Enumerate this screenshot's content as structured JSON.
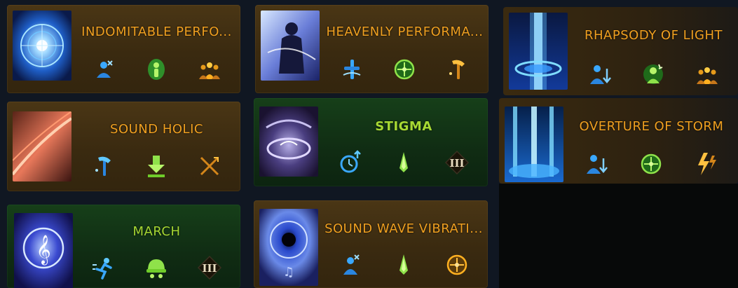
{
  "skills": [
    {
      "id": "indomitable",
      "name": "INDOMITABLE PERFO...",
      "bg": "gold",
      "thumb": "blue-mandala-icon",
      "icons": [
        "person-cross-icon",
        "green-person-icon",
        "gold-group-icon"
      ]
    },
    {
      "id": "heavenly",
      "name": "HEAVENLY PERFORMA...",
      "bg": "gold",
      "thumb": "bard-silhouette-icon",
      "icons": [
        "blue-cross-icon",
        "green-target-icon",
        "gold-hammer-icon"
      ]
    },
    {
      "id": "rhapsody",
      "name": "RHAPSODY OF LIGHT",
      "bg": "gold",
      "thumb": "light-pillar-icon",
      "icons": [
        "blue-person-down-icon",
        "green-person-burst-icon",
        "gold-group-icon"
      ]
    },
    {
      "id": "soundholic",
      "name": "SOUND HOLIC",
      "bg": "gold",
      "thumb": "orange-streak-icon",
      "icons": [
        "blue-hammer-icon",
        "green-down-arrow-icon",
        "gold-crossed-blades-icon"
      ]
    },
    {
      "id": "stigma",
      "name": "STIGMA",
      "bg": "green",
      "thumb": "purple-chains-icon",
      "icons": [
        "blue-timer-up-icon",
        "green-spike-icon",
        "tier-three-icon"
      ]
    },
    {
      "id": "overture",
      "name": "OVERTURE OF STORM",
      "bg": "gold",
      "thumb": "blue-storm-icon",
      "icons": [
        "blue-person-down-icon",
        "green-target-icon",
        "gold-lightning-icon"
      ]
    },
    {
      "id": "march",
      "name": "MARCH",
      "bg": "green",
      "thumb": "treble-clef-orb-icon",
      "icons": [
        "blue-runner-icon",
        "green-helmet-icon",
        "tier-three-icon"
      ]
    },
    {
      "id": "soundwave",
      "name": "SOUND WAVE VIBRATI...",
      "bg": "gold",
      "thumb": "vortex-note-icon",
      "icons": [
        "blue-person-cross-icon",
        "green-spike-icon",
        "gold-target-icon"
      ]
    }
  ],
  "colors": {
    "gold_text": "#f0a020",
    "green_text": "#a6d833",
    "gold_card": "#3a2a10",
    "green_card": "#102c13"
  }
}
